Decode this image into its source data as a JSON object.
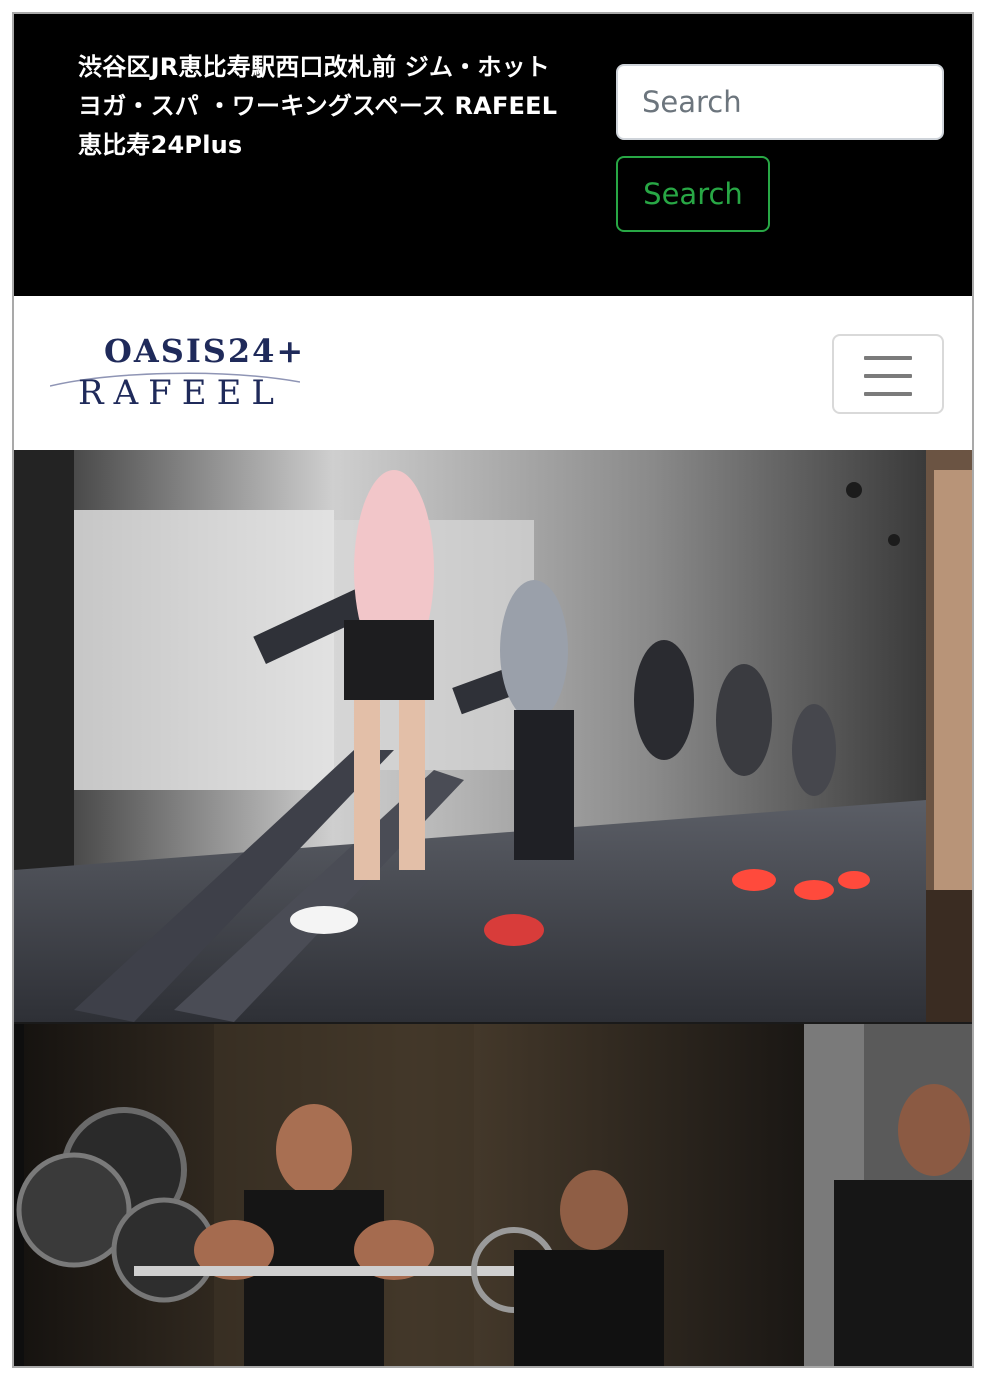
{
  "header": {
    "site_title_line1": "渋谷区JR恵比寿駅西口改札前 ジム・ホット",
    "site_title_line2": "ヨガ・スパ ・ワーキングスペース RAFEEL",
    "site_title_line3": "恵比寿24Plus"
  },
  "search": {
    "placeholder": "Search",
    "button_label": "Search",
    "accent_color": "#28a745"
  },
  "brand": {
    "logo_top": "OASIS24+",
    "logo_bottom": "RAFEEL",
    "logo_color": "#1f2a5a"
  },
  "navbar": {
    "toggler_icon": "hamburger-icon"
  },
  "hero": {
    "images": [
      {
        "subject": "treadmill-runners-photo"
      },
      {
        "subject": "weight-training-photo"
      }
    ]
  }
}
